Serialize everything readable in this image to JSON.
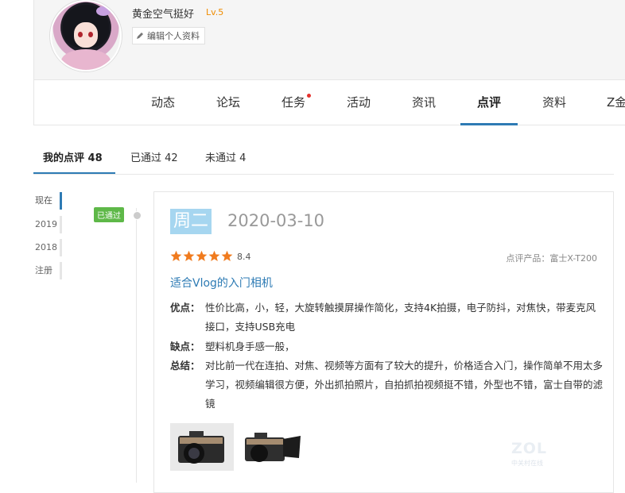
{
  "profile": {
    "username": "黄金空气挺好",
    "level": "Lv.5",
    "edit_label": "编辑个人资料"
  },
  "nav": {
    "items": [
      "动态",
      "论坛",
      "任务",
      "活动",
      "资讯",
      "点评",
      "资料",
      "Z金"
    ],
    "active": "点评",
    "notify_dot_on": "任务"
  },
  "tabs": [
    {
      "label": "我的点评 48",
      "active": true
    },
    {
      "label": "已通过 42",
      "active": false
    },
    {
      "label": "未通过 4",
      "active": false
    }
  ],
  "timeline": [
    "现在",
    "2019",
    "2018",
    "注册"
  ],
  "review": {
    "status": "已通过",
    "weekday": "周二",
    "date": "2020-03-10",
    "stars": 5,
    "score": "8.4",
    "product": "点评产品：富士X-T200",
    "title": "适合Vlog的入门相机",
    "pros_label": "优点：",
    "pros": "性价比高，小，轻，大旋转触摸屏操作简化，支持4K拍摄，电子防抖，对焦快，带麦克风接口，支持USB充电",
    "cons_label": "缺点：",
    "cons": "塑料机身手感一般，",
    "summary_label": "总结：",
    "summary": "对比前一代在连拍、对焦、视频等方面有了较大的提升，价格适合入门，操作简单不用太多学习，视频编辑很方便，外出抓拍照片，自拍抓拍视频挺不错，外型也不错，富士自带的滤镜"
  },
  "watermark": {
    "logo": "ZOL",
    "sub": "中关村在线"
  },
  "colors": {
    "accent": "#2e7bb4",
    "approved": "#5eb848",
    "star": "#f07b1e",
    "level": "#f08c00"
  }
}
